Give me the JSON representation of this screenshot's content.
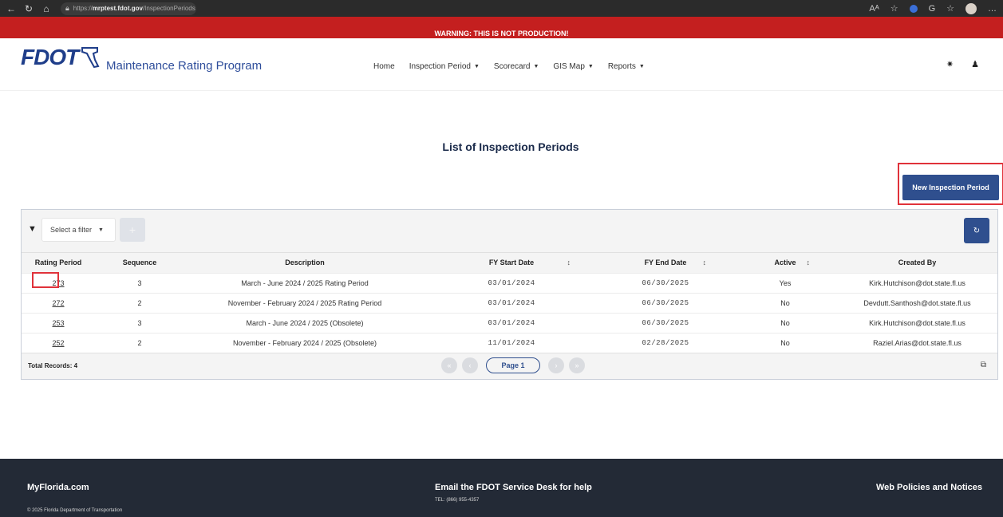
{
  "browser": {
    "url_prefix": "https://",
    "url_domain": "mrptest.fdot.gov",
    "url_path": "/InspectionPeriods",
    "icons": [
      "back-icon",
      "refresh-icon",
      "home-icon",
      "lock-icon",
      "read-aloud-icon",
      "favorite-icon",
      "extension-icon",
      "profile-icon"
    ]
  },
  "warning": "WARNING: THIS IS NOT PRODUCTION!",
  "header": {
    "logo_text": "FDOT",
    "app_title": "Maintenance Rating Program",
    "nav": [
      {
        "label": "Home"
      },
      {
        "label": "Inspection Period"
      },
      {
        "label": "Scorecard"
      },
      {
        "label": "GIS Map"
      },
      {
        "label": "Reports"
      }
    ]
  },
  "page": {
    "title": "List of Inspection Periods",
    "new_button": "New Inspection Period"
  },
  "filters": {
    "select_placeholder": "Select a filter"
  },
  "table": {
    "headers": [
      "Rating Period",
      "Sequence",
      "Description",
      "FY Start Date",
      "FY End Date",
      "Active",
      "Created By"
    ],
    "rows": [
      {
        "rating_period": "273",
        "sequence": "3",
        "description": "March - June 2024 / 2025 Rating Period",
        "fy_start": "03/01/2024",
        "fy_end": "06/30/2025",
        "active": "Yes",
        "created_by": "Kirk.Hutchison@dot.state.fl.us"
      },
      {
        "rating_period": "272",
        "sequence": "2",
        "description": "November - February 2024 / 2025 Rating Period",
        "fy_start": "03/01/2024",
        "fy_end": "06/30/2025",
        "active": "No",
        "created_by": "Devdutt.Santhosh@dot.state.fl.us"
      },
      {
        "rating_period": "253",
        "sequence": "3",
        "description": "March - June 2024 / 2025 (Obsolete)",
        "fy_start": "03/01/2024",
        "fy_end": "06/30/2025",
        "active": "No",
        "created_by": "Kirk.Hutchison@dot.state.fl.us"
      },
      {
        "rating_period": "252",
        "sequence": "2",
        "description": "November - February 2024 / 2025 (Obsolete)",
        "fy_start": "11/01/2024",
        "fy_end": "02/28/2025",
        "active": "No",
        "created_by": "Raziel.Arias@dot.state.fl.us"
      }
    ],
    "total_records": "Total Records: 4",
    "page_label": "Page 1"
  },
  "footer": {
    "left": "MyFlorida.com",
    "copyright": "© 2025 Florida Department of Transportation",
    "center": "Email the FDOT Service Desk for help",
    "tel": "TEL: (866) 955-4357",
    "right": "Web Policies and Notices"
  }
}
